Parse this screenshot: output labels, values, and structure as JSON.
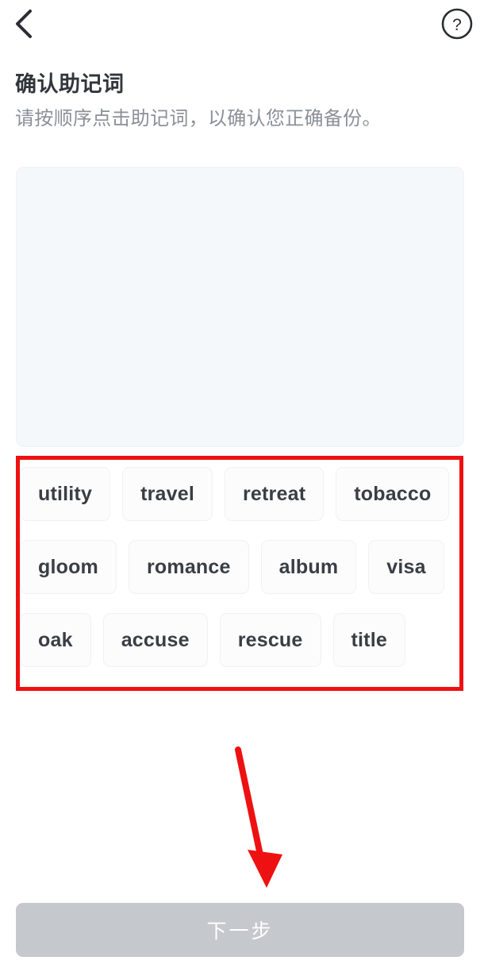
{
  "header": {
    "back_icon": "chevron-left-icon",
    "help_icon": "question-circle-icon"
  },
  "page": {
    "title": "确认助记词",
    "subtitle": "请按顺序点击助记词，以确认您正确备份。"
  },
  "dropzone": {
    "selected_words": []
  },
  "word_bank": {
    "rows": [
      [
        "utility",
        "travel",
        "retreat",
        "tobacco"
      ],
      [
        "gloom",
        "romance",
        "album",
        "visa"
      ],
      [
        "oak",
        "accuse",
        "rescue",
        "title"
      ]
    ]
  },
  "footer": {
    "next_label": "下一步"
  },
  "annotations": {
    "highlight_color": "#ef1111",
    "arrow_color": "#ee1111"
  }
}
